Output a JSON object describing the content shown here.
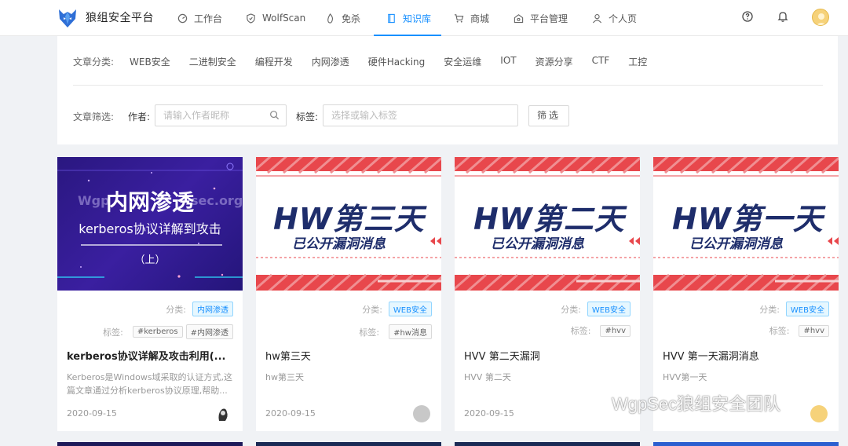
{
  "brand": "狼组安全平台",
  "nav": [
    {
      "label": "工作台",
      "icon": "dashboard-icon"
    },
    {
      "label": "WolfScan",
      "icon": "shield-icon"
    },
    {
      "label": "免杀",
      "icon": "fire-icon"
    },
    {
      "label": "知识库",
      "icon": "book-icon",
      "active": true
    },
    {
      "label": "商城",
      "icon": "cart-icon"
    },
    {
      "label": "平台管理",
      "icon": "manage-icon"
    },
    {
      "label": "个人页",
      "icon": "user-icon"
    }
  ],
  "filters": {
    "category_label": "文章分类:",
    "categories": [
      "WEB安全",
      "二进制安全",
      "编程开发",
      "内网渗透",
      "硬件Hacking",
      "安全运维",
      "IOT",
      "资源分享",
      "CTF",
      "工控"
    ],
    "filter_label": "文章筛选:",
    "author_label": "作者:",
    "author_placeholder": "请输入作者昵称",
    "tag_label": "标签:",
    "tag_placeholder": "选择或输入标签",
    "filter_button": "筛选"
  },
  "card_labels": {
    "category": "分类:",
    "tags": "标签:"
  },
  "cards": [
    {
      "thumb_title": "内网渗透",
      "thumb_subtitle": "kerberos协议详解到攻击",
      "thumb_part": "（上）",
      "thumb_watermark": "Wgp",
      "thumb_watermark2": "sec.org",
      "category": "内网渗透",
      "tags": [
        "#kerberos",
        "#内网渗透"
      ],
      "title": "kerberos协议详解及攻击利用(...",
      "desc": "Kerberos是Windows域采取的认证方式,这篇文章通过分析kerberos协议原理,帮助...",
      "date": "2020-09-15"
    },
    {
      "thumb_title": "HW第三天",
      "thumb_subtitle": "已公开漏洞消息",
      "category": "WEB安全",
      "tags": [
        "#hw消息"
      ],
      "title": "hw第三天",
      "desc": "hw第三天",
      "date": "2020-09-15"
    },
    {
      "thumb_title": "HW第二天",
      "thumb_subtitle": "已公开漏洞消息",
      "category": "WEB安全",
      "tags": [
        "#hvv"
      ],
      "title": "HVV 第二天漏洞",
      "desc": "HVV 第二天",
      "date": "2020-09-15"
    },
    {
      "thumb_title": "HW第一天",
      "thumb_subtitle": "已公开漏洞消息",
      "category": "WEB安全",
      "tags": [
        "#hvv"
      ],
      "title": "HVV 第一天漏洞消息",
      "desc": "HVV第一天",
      "date": ""
    }
  ],
  "watermark": "WgpSec狼组安全团队",
  "colors": {
    "accent": "#1890ff",
    "hw_red": "#e8474c",
    "hw_navy": "#1e2d6b",
    "kerb_purple": "#2b1a8a"
  }
}
